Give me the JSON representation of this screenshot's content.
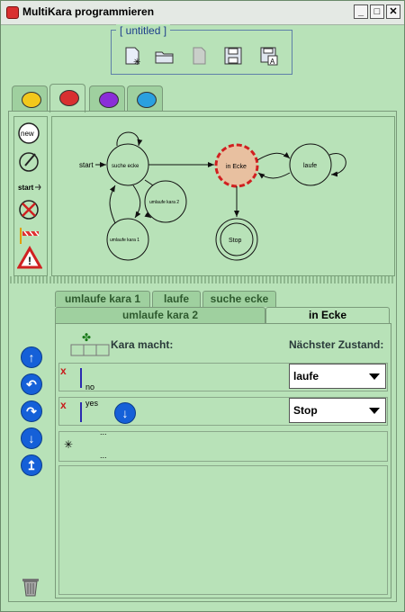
{
  "window": {
    "title": "MultiKara programmieren"
  },
  "file_panel": {
    "label": "[ untitled ]",
    "buttons": [
      "new-file-icon",
      "open-folder-icon",
      "reload-icon",
      "save-icon",
      "save-as-icon"
    ]
  },
  "kara_tabs": [
    {
      "color": "#f2c81c"
    },
    {
      "color": "#d83030"
    },
    {
      "color": "#8a2ed8"
    },
    {
      "color": "#2aa0e0"
    }
  ],
  "toolbox": {
    "new_label": "new",
    "start_label": "start"
  },
  "graph": {
    "states": {
      "suche_ecke": "suche ecke",
      "in_ecke": "in Ecke",
      "laufe": "laufe",
      "umlaufe_2": "umlaufe kara 2",
      "umlaufe_1": "umlaufe kara 1",
      "stop": "Stop"
    },
    "start_label": "start"
  },
  "state_tabs_row1": [
    "umlaufe kara 1",
    "laufe",
    "suche ecke"
  ],
  "state_tabs_row2": [
    "umlaufe kara 2",
    "in Ecke"
  ],
  "transitions": {
    "header_kara": "Kara macht:",
    "header_next": "Nächster Zustand:",
    "rows": [
      {
        "cond": "no",
        "next": "laufe"
      },
      {
        "cond": "yes",
        "next": "Stop"
      }
    ],
    "new_row_dots": "..."
  }
}
